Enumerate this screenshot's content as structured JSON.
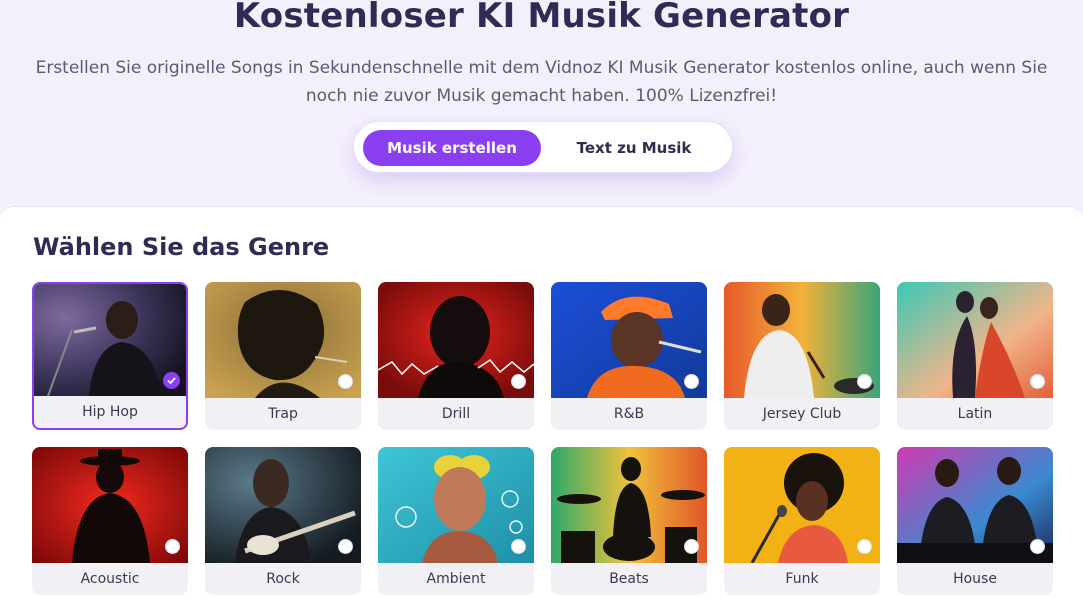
{
  "hero": {
    "title": "Kostenloser KI Musik Generator",
    "subtitle": "Erstellen Sie originelle Songs in Sekundenschnelle mit dem Vidnoz KI Musik Generator kostenlos online, auch wenn Sie noch nie zuvor Musik gemacht haben. 100% Lizenzfrei!"
  },
  "tabs": [
    {
      "label": "Musik erstellen",
      "active": true
    },
    {
      "label": "Text zu Musik",
      "active": false
    }
  ],
  "section_title": "Wählen Sie das Genre",
  "accent_color": "#8a3ff0",
  "genres": [
    {
      "label": "Hip Hop",
      "selected": true
    },
    {
      "label": "Trap",
      "selected": false
    },
    {
      "label": "Drill",
      "selected": false
    },
    {
      "label": "R&B",
      "selected": false
    },
    {
      "label": "Jersey Club",
      "selected": false
    },
    {
      "label": "Latin",
      "selected": false
    },
    {
      "label": "Acoustic",
      "selected": false
    },
    {
      "label": "Rock",
      "selected": false
    },
    {
      "label": "Ambient",
      "selected": false
    },
    {
      "label": "Beats",
      "selected": false
    },
    {
      "label": "Funk",
      "selected": false
    },
    {
      "label": "House",
      "selected": false
    }
  ]
}
